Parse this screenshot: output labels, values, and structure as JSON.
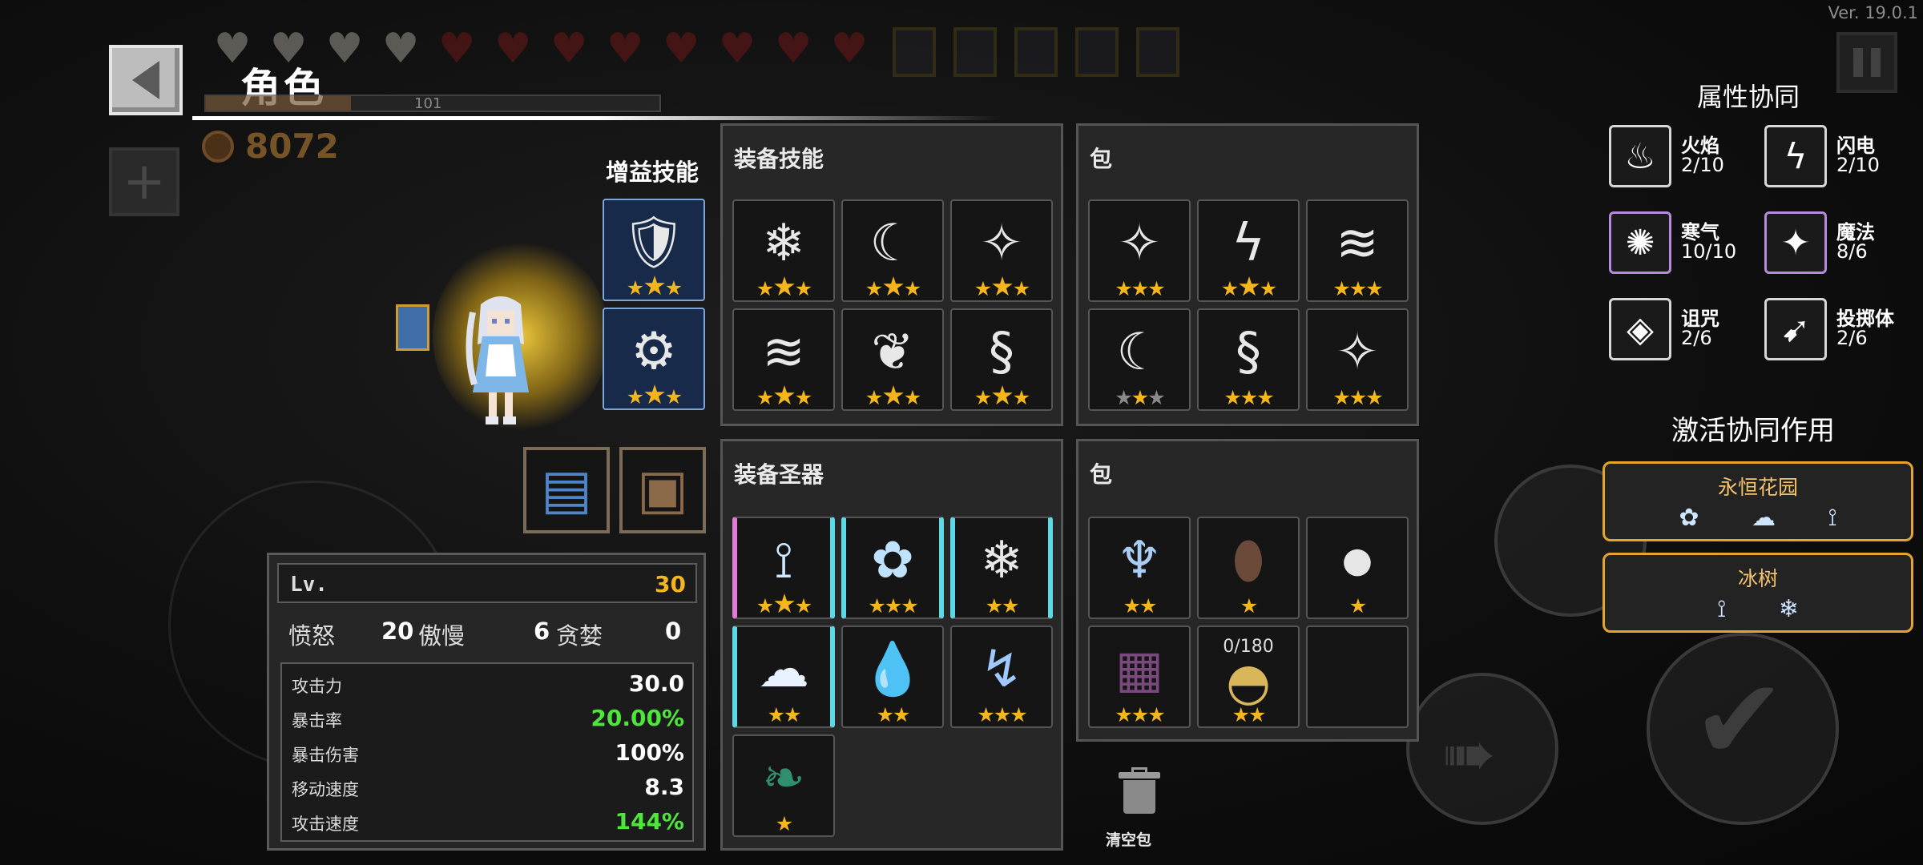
{
  "version": "Ver. 19.0.1",
  "header": {
    "title": "角色",
    "xp_text": "101",
    "coins": "8072"
  },
  "buff": {
    "title": "增益技能",
    "slots": [
      {
        "icon": "shield-snowflake-icon",
        "glyph": "🛡",
        "stars": 3,
        "big_index": 1
      },
      {
        "icon": "frost-armor-icon",
        "glyph": "⚙",
        "stars": 3,
        "big_index": 1
      }
    ]
  },
  "equip_skills": {
    "title": "装备技能",
    "slots": [
      {
        "icon": "snowflake-orb-icon",
        "glyph": "❄"
      },
      {
        "icon": "crescent-slash-icon",
        "glyph": "☾"
      },
      {
        "icon": "ice-shard-icon",
        "glyph": "✧"
      },
      {
        "icon": "wind-streak-icon",
        "glyph": "≋"
      },
      {
        "icon": "winged-orb-icon",
        "glyph": "❦"
      },
      {
        "icon": "dragon-icon",
        "glyph": "§"
      }
    ]
  },
  "skill_bag": {
    "title": "包",
    "slots": [
      {
        "icon": "ice-shard-icon",
        "glyph": "✧"
      },
      {
        "icon": "lightning-orb-icon",
        "glyph": "ϟ"
      },
      {
        "icon": "wind-streak-icon",
        "glyph": "≋"
      },
      {
        "icon": "crescent-slash-icon",
        "glyph": "☾"
      },
      {
        "icon": "dragon-icon",
        "glyph": "§"
      },
      {
        "icon": "ice-shard-icon",
        "glyph": "✧"
      }
    ]
  },
  "equip_relics": {
    "title": "装备圣器",
    "slots": [
      {
        "icon": "ice-branch-icon",
        "glyph": "⟟"
      },
      {
        "icon": "ice-flower-icon",
        "glyph": "✿"
      },
      {
        "icon": "snowflake-icon",
        "glyph": "❄"
      },
      {
        "icon": "snow-cloud-icon",
        "glyph": "☁"
      },
      {
        "icon": "water-drop-icon",
        "glyph": "💧"
      },
      {
        "icon": "lightning-spear-icon",
        "glyph": "↯"
      },
      {
        "icon": "green-leaf-icon",
        "glyph": "❧"
      }
    ]
  },
  "relic_bag": {
    "title": "包",
    "slots": [
      {
        "icon": "ice-crystal-icon",
        "glyph": "♆"
      },
      {
        "icon": "brown-pouch-icon",
        "glyph": "⬮"
      },
      {
        "icon": "white-orb-icon",
        "glyph": "●"
      },
      {
        "icon": "cursed-chest-icon",
        "glyph": "▦"
      },
      {
        "icon": "egg-nest-icon",
        "glyph": "◓",
        "count": "0/180"
      },
      {
        "icon": "",
        "glyph": ""
      }
    ]
  },
  "stats": {
    "lv_label": "Lv.",
    "lv_value": "30",
    "wrath_label": "愤怒",
    "wrath_value": "20",
    "pride_label": "傲慢",
    "pride_value": "6",
    "greed_label": "贪婪",
    "greed_value": "0",
    "lines": [
      {
        "label": "攻击力",
        "value": "30.0",
        "color": "#ffffff"
      },
      {
        "label": "暴击率",
        "value": "20.00%",
        "color": "#4ee63b"
      },
      {
        "label": "暴击伤害",
        "value": "100%",
        "color": "#ffffff"
      },
      {
        "label": "移动速度",
        "value": "8.3",
        "color": "#ffffff"
      },
      {
        "label": "攻击速度",
        "value": "144%",
        "color": "#4ee63b"
      }
    ]
  },
  "clear_bag": "清空包",
  "synergy": {
    "title": "属性协同",
    "items": [
      {
        "name": "火焰",
        "count": "2/10",
        "icon": "flame-icon",
        "glyph": "♨"
      },
      {
        "name": "闪电",
        "count": "2/10",
        "icon": "lightning-icon",
        "glyph": "ϟ"
      },
      {
        "name": "寒气",
        "count": "10/10",
        "icon": "frost-icon",
        "glyph": "✺"
      },
      {
        "name": "魔法",
        "count": "8/6",
        "icon": "magic-star-icon",
        "glyph": "✦"
      },
      {
        "name": "诅咒",
        "count": "2/6",
        "icon": "curse-eye-icon",
        "glyph": "◈"
      },
      {
        "name": "投掷体",
        "count": "2/6",
        "icon": "projectile-icon",
        "glyph": "➹"
      }
    ]
  },
  "active": {
    "title": "激活协同作用",
    "combos": [
      {
        "name": "永恒花园",
        "icons": "✿ ☁ ⟟"
      },
      {
        "name": "冰树",
        "icons": "⟟ ❄"
      }
    ]
  },
  "colors": {
    "star": "#f5b51d",
    "accent": "#e6a52a",
    "green": "#4ee63b",
    "buff_bg": "#182a4a"
  }
}
